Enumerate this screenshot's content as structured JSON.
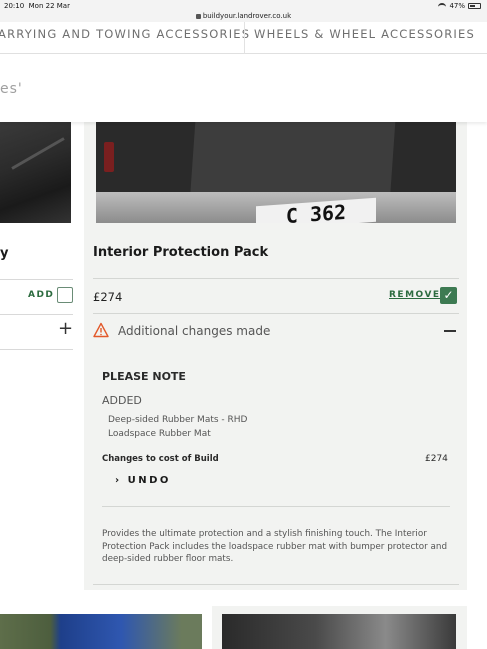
{
  "status_bar": {
    "time": "20:10",
    "date": "Mon 22 Mar",
    "url": "buildyour.landrover.co.uk",
    "battery": "47%"
  },
  "nav": {
    "tab_carrying": "ARRYING AND TOWING ACCESSORIES",
    "tab_wheels": "WHEELS & WHEEL ACCESSORIES"
  },
  "header": {
    "partial_text": "es'"
  },
  "left_card": {
    "title_fragment": "y",
    "add_label": "ADD"
  },
  "card": {
    "title": "Interior Protection Pack",
    "price": "£274",
    "remove_label": "REMOVE",
    "plate_text": "C 362",
    "changes_label": "Additional changes made",
    "note_title": "PLEASE NOTE",
    "added_label": "ADDED",
    "added_items": [
      "Deep-sided Rubber Mats - RHD",
      "Loadspace Rubber Mat"
    ],
    "cost_label": "Changes to cost of Build",
    "cost_value": "£274",
    "undo_label": "UNDO",
    "description": "Provides the ultimate protection and a stylish finishing touch. The Interior Protection Pack includes the loadspace rubber mat with bumper protector and deep-sided rubber floor mats."
  },
  "colors": {
    "accent_green": "#2c6b3f",
    "card_bg": "#f2f3f1",
    "warning_orange": "#e2592b"
  }
}
